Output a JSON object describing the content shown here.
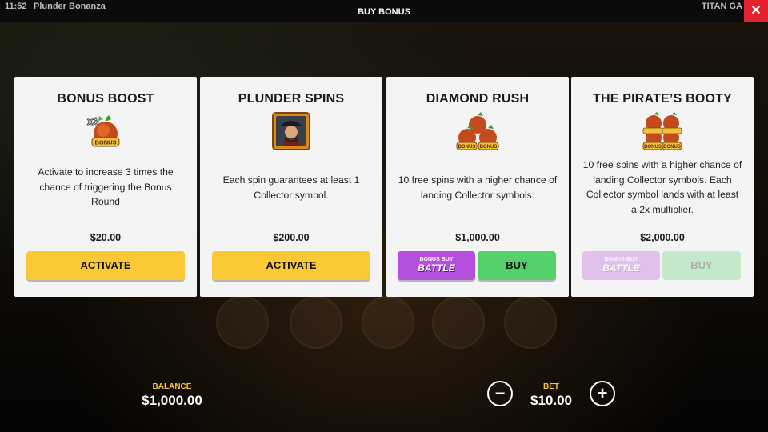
{
  "topbar": {
    "time": "11:52",
    "game_name": "Plunder Bonanza",
    "title": "BUY BONUS",
    "provider": "TITAN GA",
    "close_icon": "close-icon"
  },
  "cards": [
    {
      "title": "BONUS BOOST",
      "icon": "bonus-boost-icon",
      "icon_badge": "x3",
      "description": "Activate to increase 3 times the chance of triggering the Bonus Round",
      "price": "$20.00",
      "button": "ACTIVATE"
    },
    {
      "title": "PLUNDER SPINS",
      "icon": "pirate-captain-icon",
      "description": "Each spin guarantees at least 1 Collector symbol.",
      "price": "$200.00",
      "button": "ACTIVATE"
    },
    {
      "title": "DIAMOND RUSH",
      "icon": "bonus-chests-icon",
      "description": "10 free spins with a higher chance of landing Collector symbols.",
      "price": "$1,000.00",
      "battle_button": [
        "BONUS BUY",
        "BATTLE"
      ],
      "button": "BUY"
    },
    {
      "title": "THE PIRATE’S BOOTY",
      "icon": "bonus-chests-stack-icon",
      "description": "10 free spins with a higher chance of landing Collector symbols. Each Collector symbol lands with at least a 2x multiplier.",
      "price": "$2,000.00",
      "battle_button": [
        "BONUS BUY",
        "BATTLE"
      ],
      "button": "BUY",
      "disabled": true
    }
  ],
  "bonus_label": "BONUS",
  "bottom": {
    "balance_label": "BALANCE",
    "balance_value": "$1,000.00",
    "bet_label": "BET",
    "bet_value": "$10.00",
    "minus_icon": "minus-icon",
    "plus_icon": "plus-icon"
  },
  "colors": {
    "accent_yellow": "#fbc936",
    "buy_green": "#55d16b",
    "battle_purple": "#b44fde",
    "close_red": "#e3212f",
    "label_yellow": "#f6c63a"
  }
}
